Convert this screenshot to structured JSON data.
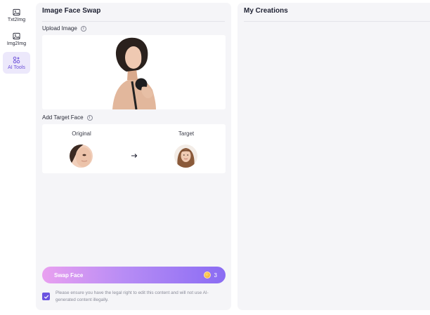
{
  "nav": {
    "items": [
      {
        "label": "Txt2Img",
        "icon": "image-icon"
      },
      {
        "label": "Img2Img",
        "icon": "image-icon"
      },
      {
        "label": "AI Tools",
        "icon": "tools-icon",
        "active": true
      }
    ]
  },
  "left_panel": {
    "title": "Image Face Swap",
    "upload_label": "Upload Image",
    "target_label": "Add Target Face",
    "original_label": "Original",
    "target_col_label": "Target",
    "swap_button": "Swap Face",
    "credits": "3",
    "consent": "Please ensure you have the legal right to edit this content and will not use AI-generated content illegally.",
    "consent_checked": true
  },
  "right_panel": {
    "title": "My Creations"
  },
  "colors": {
    "accent": "#6c54e0",
    "panel_bg": "#f5f5f8",
    "active_nav_bg": "#ece8fb",
    "button_gradient_start": "#e9a0f0",
    "button_gradient_end": "#8a6cf3"
  }
}
